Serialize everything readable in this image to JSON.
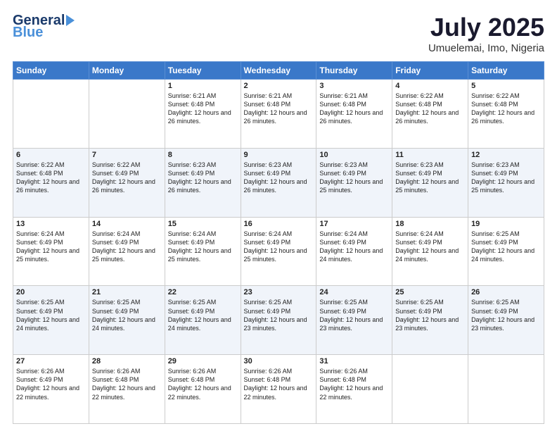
{
  "header": {
    "logo_general": "General",
    "logo_blue": "Blue",
    "month_title": "July 2025",
    "location": "Umuelemai, Imo, Nigeria"
  },
  "days_of_week": [
    "Sunday",
    "Monday",
    "Tuesday",
    "Wednesday",
    "Thursday",
    "Friday",
    "Saturday"
  ],
  "weeks": [
    [
      {
        "day": "",
        "info": ""
      },
      {
        "day": "",
        "info": ""
      },
      {
        "day": "1",
        "info": "Sunrise: 6:21 AM\nSunset: 6:48 PM\nDaylight: 12 hours and 26 minutes."
      },
      {
        "day": "2",
        "info": "Sunrise: 6:21 AM\nSunset: 6:48 PM\nDaylight: 12 hours and 26 minutes."
      },
      {
        "day": "3",
        "info": "Sunrise: 6:21 AM\nSunset: 6:48 PM\nDaylight: 12 hours and 26 minutes."
      },
      {
        "day": "4",
        "info": "Sunrise: 6:22 AM\nSunset: 6:48 PM\nDaylight: 12 hours and 26 minutes."
      },
      {
        "day": "5",
        "info": "Sunrise: 6:22 AM\nSunset: 6:48 PM\nDaylight: 12 hours and 26 minutes."
      }
    ],
    [
      {
        "day": "6",
        "info": "Sunrise: 6:22 AM\nSunset: 6:48 PM\nDaylight: 12 hours and 26 minutes."
      },
      {
        "day": "7",
        "info": "Sunrise: 6:22 AM\nSunset: 6:49 PM\nDaylight: 12 hours and 26 minutes."
      },
      {
        "day": "8",
        "info": "Sunrise: 6:23 AM\nSunset: 6:49 PM\nDaylight: 12 hours and 26 minutes."
      },
      {
        "day": "9",
        "info": "Sunrise: 6:23 AM\nSunset: 6:49 PM\nDaylight: 12 hours and 26 minutes."
      },
      {
        "day": "10",
        "info": "Sunrise: 6:23 AM\nSunset: 6:49 PM\nDaylight: 12 hours and 25 minutes."
      },
      {
        "day": "11",
        "info": "Sunrise: 6:23 AM\nSunset: 6:49 PM\nDaylight: 12 hours and 25 minutes."
      },
      {
        "day": "12",
        "info": "Sunrise: 6:23 AM\nSunset: 6:49 PM\nDaylight: 12 hours and 25 minutes."
      }
    ],
    [
      {
        "day": "13",
        "info": "Sunrise: 6:24 AM\nSunset: 6:49 PM\nDaylight: 12 hours and 25 minutes."
      },
      {
        "day": "14",
        "info": "Sunrise: 6:24 AM\nSunset: 6:49 PM\nDaylight: 12 hours and 25 minutes."
      },
      {
        "day": "15",
        "info": "Sunrise: 6:24 AM\nSunset: 6:49 PM\nDaylight: 12 hours and 25 minutes."
      },
      {
        "day": "16",
        "info": "Sunrise: 6:24 AM\nSunset: 6:49 PM\nDaylight: 12 hours and 25 minutes."
      },
      {
        "day": "17",
        "info": "Sunrise: 6:24 AM\nSunset: 6:49 PM\nDaylight: 12 hours and 24 minutes."
      },
      {
        "day": "18",
        "info": "Sunrise: 6:24 AM\nSunset: 6:49 PM\nDaylight: 12 hours and 24 minutes."
      },
      {
        "day": "19",
        "info": "Sunrise: 6:25 AM\nSunset: 6:49 PM\nDaylight: 12 hours and 24 minutes."
      }
    ],
    [
      {
        "day": "20",
        "info": "Sunrise: 6:25 AM\nSunset: 6:49 PM\nDaylight: 12 hours and 24 minutes."
      },
      {
        "day": "21",
        "info": "Sunrise: 6:25 AM\nSunset: 6:49 PM\nDaylight: 12 hours and 24 minutes."
      },
      {
        "day": "22",
        "info": "Sunrise: 6:25 AM\nSunset: 6:49 PM\nDaylight: 12 hours and 24 minutes."
      },
      {
        "day": "23",
        "info": "Sunrise: 6:25 AM\nSunset: 6:49 PM\nDaylight: 12 hours and 23 minutes."
      },
      {
        "day": "24",
        "info": "Sunrise: 6:25 AM\nSunset: 6:49 PM\nDaylight: 12 hours and 23 minutes."
      },
      {
        "day": "25",
        "info": "Sunrise: 6:25 AM\nSunset: 6:49 PM\nDaylight: 12 hours and 23 minutes."
      },
      {
        "day": "26",
        "info": "Sunrise: 6:25 AM\nSunset: 6:49 PM\nDaylight: 12 hours and 23 minutes."
      }
    ],
    [
      {
        "day": "27",
        "info": "Sunrise: 6:26 AM\nSunset: 6:49 PM\nDaylight: 12 hours and 22 minutes."
      },
      {
        "day": "28",
        "info": "Sunrise: 6:26 AM\nSunset: 6:48 PM\nDaylight: 12 hours and 22 minutes."
      },
      {
        "day": "29",
        "info": "Sunrise: 6:26 AM\nSunset: 6:48 PM\nDaylight: 12 hours and 22 minutes."
      },
      {
        "day": "30",
        "info": "Sunrise: 6:26 AM\nSunset: 6:48 PM\nDaylight: 12 hours and 22 minutes."
      },
      {
        "day": "31",
        "info": "Sunrise: 6:26 AM\nSunset: 6:48 PM\nDaylight: 12 hours and 22 minutes."
      },
      {
        "day": "",
        "info": ""
      },
      {
        "day": "",
        "info": ""
      }
    ]
  ]
}
